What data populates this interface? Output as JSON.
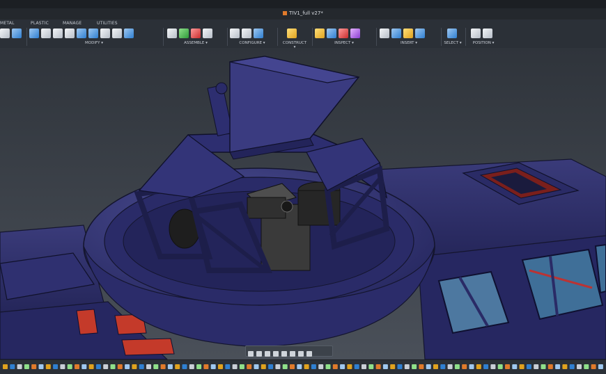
{
  "window": {
    "document_title": "TIV1_full v27*"
  },
  "ribbon": {
    "tabs": [
      "METAL",
      "PLASTIC",
      "MANAGE",
      "UTILITIES"
    ],
    "groups": [
      "MODIFY",
      "ASSEMBLE",
      "CONFIGURE",
      "CONSTRUCT",
      "INSPECT",
      "INSERT",
      "SELECT",
      "POSITION"
    ]
  },
  "icons": {
    "document": "cube-icon",
    "navigation": [
      "orbit-icon",
      "look-at-icon",
      "pan-icon",
      "zoom-icon",
      "fit-icon",
      "display-settings-icon",
      "grid-icon",
      "viewports-icon"
    ]
  },
  "colors": {
    "background": "#3a3f47",
    "model_body": "#2e2f66",
    "model_edge": "#14152e",
    "accent_red": "#c43a2a"
  }
}
